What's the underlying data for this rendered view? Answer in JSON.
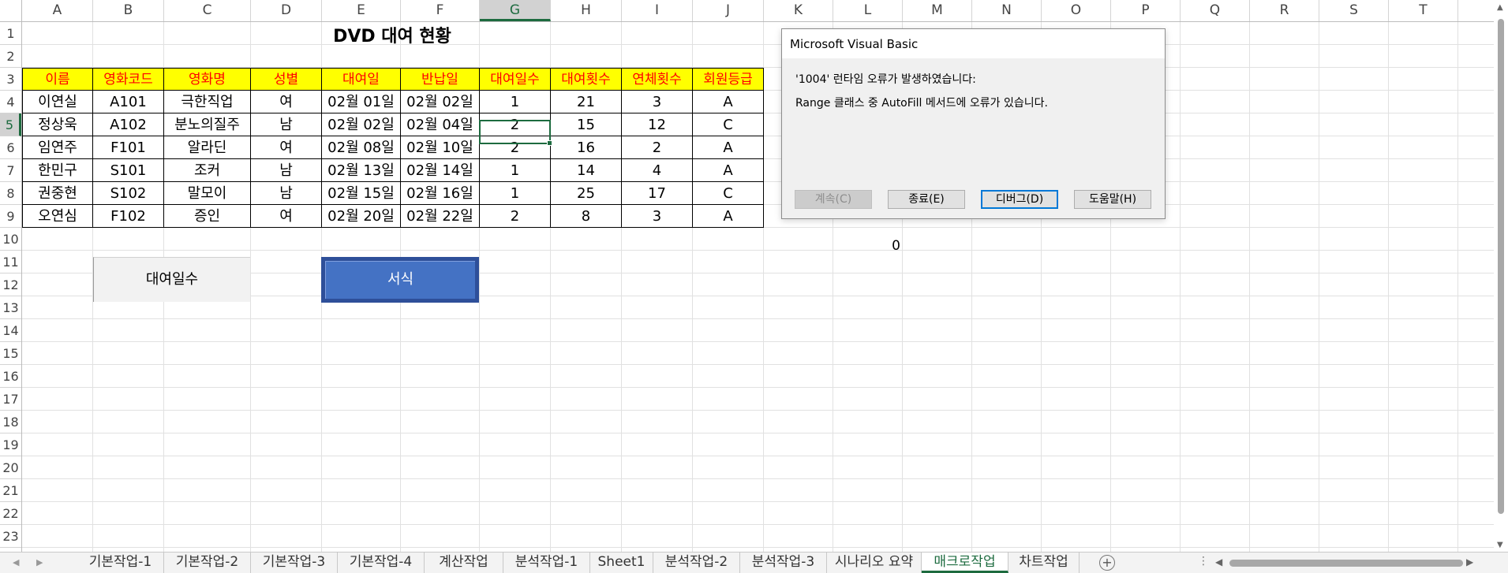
{
  "columns": [
    "A",
    "B",
    "C",
    "D",
    "E",
    "F",
    "G",
    "H",
    "I",
    "J",
    "K",
    "L",
    "M",
    "N",
    "O",
    "P",
    "Q",
    "R",
    "S",
    "T"
  ],
  "rows": [
    "1",
    "2",
    "3",
    "4",
    "5",
    "6",
    "7",
    "8",
    "9",
    "10",
    "11",
    "12",
    "13",
    "14",
    "15",
    "16",
    "17",
    "18",
    "19",
    "20",
    "21",
    "22",
    "23"
  ],
  "selected_column": "G",
  "selected_row": "5",
  "sheet_title": "DVD 대여 현황",
  "table": {
    "headers": [
      "이름",
      "영화코드",
      "영화명",
      "성별",
      "대여일",
      "반납일",
      "대여일수",
      "대여횟수",
      "연체횟수",
      "회원등급"
    ],
    "rows": [
      [
        "이연실",
        "A101",
        "극한직업",
        "여",
        "02월 01일",
        "02월 02일",
        "1",
        "21",
        "3",
        "A"
      ],
      [
        "정상욱",
        "A102",
        "분노의질주",
        "남",
        "02월 02일",
        "02월 04일",
        "2",
        "15",
        "12",
        "C"
      ],
      [
        "임연주",
        "F101",
        "알라딘",
        "여",
        "02월 08일",
        "02월 10일",
        "2",
        "16",
        "2",
        "A"
      ],
      [
        "한민구",
        "S101",
        "조커",
        "남",
        "02월 13일",
        "02월 14일",
        "1",
        "14",
        "4",
        "A"
      ],
      [
        "권중현",
        "S102",
        "말모이",
        "남",
        "02월 15일",
        "02월 16일",
        "1",
        "25",
        "17",
        "C"
      ],
      [
        "오연심",
        "F102",
        "증인",
        "여",
        "02월 20일",
        "02월 22일",
        "2",
        "8",
        "3",
        "A"
      ]
    ]
  },
  "cell_L10": "0",
  "shapes": {
    "rental_days_button": "대여일수",
    "format_button": "서식"
  },
  "dialog": {
    "title": "Microsoft Visual Basic",
    "message_line1": "'1004' 런타임 오류가 발생하였습니다:",
    "message_line2": "Range 클래스 중 AutoFill 메서드에 오류가 있습니다.",
    "buttons": {
      "continue": "계속(C)",
      "end": "종료(E)",
      "debug": "디버그(D)",
      "help": "도움말(H)"
    }
  },
  "sheet_tabs": [
    "기본작업-1",
    "기본작업-2",
    "기본작업-3",
    "기본작업-4",
    "계산작업",
    "분석작업-1",
    "Sheet1",
    "분석작업-2",
    "분석작업-3",
    "시나리오 요약",
    "매크로작업",
    "차트작업"
  ],
  "active_sheet": "매크로작업",
  "colors": {
    "header_fill": "#ffff00",
    "header_text": "#ff0000",
    "selection_green": "#1d6b3f",
    "format_button_fill": "#4472c4",
    "dialog_bg": "#f0f0f0"
  }
}
